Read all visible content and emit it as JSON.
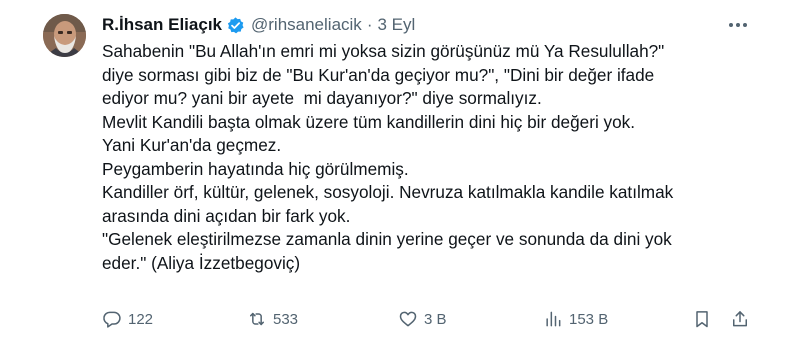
{
  "author": {
    "name": "R.İhsan Eliaçık",
    "handle": "@rihsaneliacik",
    "separator": "·",
    "date": "3 Eyl",
    "verified": true
  },
  "tweet_lines": [
    "Sahabenin \"Bu Allah'ın emri mi yoksa sizin görüşünüz mü Ya Resulullah?\"",
    "diye sorması gibi biz de \"Bu Kur'an'da geçiyor mu?\", \"Dini bir değer ifade",
    "ediyor mu? yani bir ayete  mi dayanıyor?\" diye sormalıyız.",
    "Mevlit Kandili başta olmak üzere tüm kandillerin dini hiç bir değeri yok.",
    "Yani Kur'an'da geçmez.",
    "Peygamberin hayatında hiç görülmemiş.",
    "Kandiller örf, kültür, gelenek, sosyoloji. Nevruza katılmakla kandile katılmak",
    "arasında dini açıdan bir fark yok.",
    "\"Gelenek eleştirilmezse zamanla dinin yerine geçer ve sonunda da dini yok",
    "eder.\" (Aliya İzzetbegoviç)"
  ],
  "actions": {
    "replies": "122",
    "reposts": "533",
    "likes": "3 B",
    "views": "153 B"
  },
  "icons": {
    "verified": "verified-badge-icon",
    "more": "more-options-icon",
    "reply": "reply-icon",
    "repost": "repost-icon",
    "like": "heart-icon",
    "views": "views-chart-icon",
    "bookmark": "bookmark-icon",
    "share": "share-icon"
  },
  "colors": {
    "accent": "#1d9bf0",
    "text": "#0f1419",
    "secondary": "#536471"
  }
}
